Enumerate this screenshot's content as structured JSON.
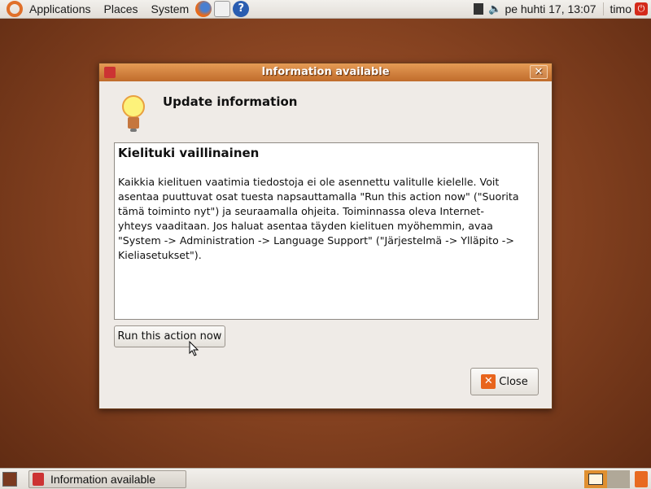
{
  "top_panel": {
    "menus": [
      "Applications",
      "Places",
      "System"
    ],
    "clock": "pe huhti  17, 13:07",
    "user": "timo"
  },
  "dialog": {
    "title": "Information available",
    "heading": "Update information",
    "message_title": "Kielituki vaillinainen",
    "message_lines": [
      "Kaikkia kielituen vaatimia tiedostoja ei ole asennettu valitulle kielelle. Voit",
      "asentaa puuttuvat osat tuesta napsauttamalla \"Run this action now\" (\"Suorita",
      "tämä toiminto nyt\") ja seuraamalla ohjeita. Toiminnassa oleva Internet-",
      "yhteys vaaditaan. Jos haluat asentaa täyden kielituen myöhemmin, avaa",
      "\"System -> Administration -> Language Support\" (\"Järjestelmä -> Ylläpito ->",
      "Kieliasetukset\")."
    ],
    "run_button": "Run this action now",
    "close_button": "Close"
  },
  "bottom_panel": {
    "task": "Information available"
  },
  "colors": {
    "title_bar": "#d4823f",
    "accent": "#e05a1c"
  }
}
